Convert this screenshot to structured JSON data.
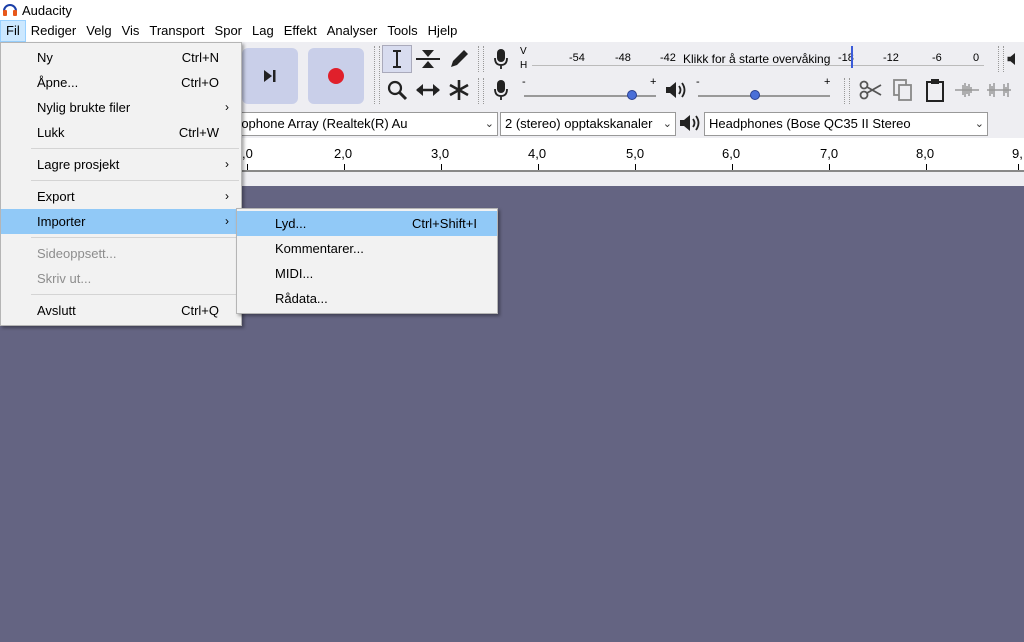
{
  "window": {
    "title": "Audacity"
  },
  "menubar": [
    "Fil",
    "Rediger",
    "Velg",
    "Vis",
    "Transport",
    "Spor",
    "Lag",
    "Effekt",
    "Analyser",
    "Tools",
    "Hjelp"
  ],
  "file_menu": {
    "items": [
      {
        "label": "Ny",
        "shortcut": "Ctrl+N"
      },
      {
        "label": "Åpne...",
        "shortcut": "Ctrl+O"
      },
      {
        "label": "Nylig brukte filer",
        "arrow": "›"
      },
      {
        "label": "Lukk",
        "shortcut": "Ctrl+W"
      },
      {
        "label": "Lagre prosjekt",
        "arrow": "›"
      },
      {
        "label": "Export",
        "arrow": "›"
      },
      {
        "label": "Importer",
        "arrow": "›"
      },
      {
        "label": "Sideoppsett..."
      },
      {
        "label": "Skriv ut..."
      },
      {
        "label": "Avslutt",
        "shortcut": "Ctrl+Q"
      }
    ]
  },
  "import_submenu": {
    "items": [
      {
        "label": "Lyd...",
        "shortcut": "Ctrl+Shift+I"
      },
      {
        "label": "Kommentarer..."
      },
      {
        "label": "MIDI..."
      },
      {
        "label": "Rådata..."
      }
    ]
  },
  "meter": {
    "v": "V",
    "h": "H",
    "scale": [
      "-54",
      "-48",
      "-42",
      "-18",
      "-12",
      "-6",
      "0"
    ],
    "prompt": "Klikk for å starte overvåking"
  },
  "mixer": {
    "minus": "-",
    "plus": "+"
  },
  "devices": {
    "input": "rophone Array (Realtek(R) Au",
    "channels": "2 (stereo) opptakskanaler",
    "output": "Headphones (Bose QC35 II Stereo"
  },
  "ruler": {
    "ticks": [
      ",0",
      "2,0",
      "3,0",
      "4,0",
      "5,0",
      "6,0",
      "7,0",
      "8,0",
      "9,"
    ]
  },
  "colors": {
    "record": "#e0202b",
    "workspace": "#646482",
    "highlight": "#91c9f7"
  }
}
